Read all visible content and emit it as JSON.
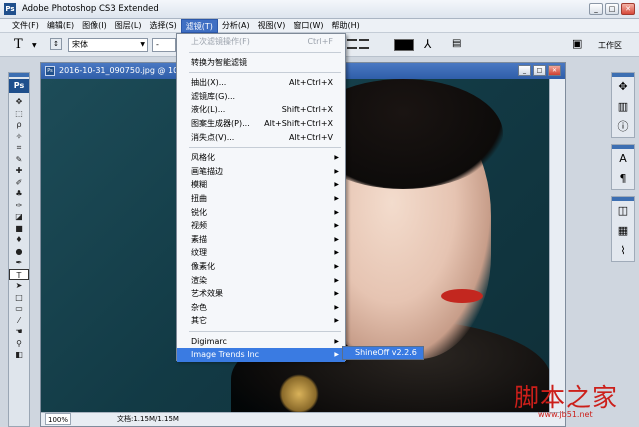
{
  "app": {
    "title": "Adobe Photoshop CS3 Extended",
    "logo": "Ps",
    "window_buttons": {
      "minimize": "_",
      "maximize": "□",
      "close": "✕"
    }
  },
  "menubar": {
    "items": [
      {
        "label": "文件(F)"
      },
      {
        "label": "编辑(E)"
      },
      {
        "label": "图像(I)"
      },
      {
        "label": "图层(L)"
      },
      {
        "label": "选择(S)"
      },
      {
        "label": "滤镜(T)",
        "active": true
      },
      {
        "label": "分析(A)"
      },
      {
        "label": "视图(V)"
      },
      {
        "label": "窗口(W)"
      },
      {
        "label": "帮助(H)"
      }
    ]
  },
  "options_bar": {
    "tool_glyph": "T",
    "font_family": "宋体",
    "font_style": "-",
    "text_color": "#000000",
    "workspace_label": "工作区"
  },
  "document": {
    "title": "2016-10-31_090750.jpg @ 100%",
    "zoom": "100%",
    "doc_size": "文档:1.15M/1.15M"
  },
  "filter_menu": {
    "items": [
      {
        "label": "上次滤镜操作(F)",
        "shortcut": "Ctrl+F",
        "disabled": true
      },
      {
        "sep": true
      },
      {
        "label": "转换为智能滤镜"
      },
      {
        "sep": true
      },
      {
        "label": "抽出(X)...",
        "shortcut": "Alt+Ctrl+X"
      },
      {
        "label": "滤镜库(G)..."
      },
      {
        "label": "液化(L)...",
        "shortcut": "Shift+Ctrl+X"
      },
      {
        "label": "图案生成器(P)...",
        "shortcut": "Alt+Shift+Ctrl+X"
      },
      {
        "label": "消失点(V)...",
        "shortcut": "Alt+Ctrl+V"
      },
      {
        "sep": true
      },
      {
        "label": "风格化",
        "submenu": true
      },
      {
        "label": "画笔描边",
        "submenu": true
      },
      {
        "label": "模糊",
        "submenu": true
      },
      {
        "label": "扭曲",
        "submenu": true
      },
      {
        "label": "锐化",
        "submenu": true
      },
      {
        "label": "视频",
        "submenu": true
      },
      {
        "label": "素描",
        "submenu": true
      },
      {
        "label": "纹理",
        "submenu": true
      },
      {
        "label": "像素化",
        "submenu": true
      },
      {
        "label": "渲染",
        "submenu": true
      },
      {
        "label": "艺术效果",
        "submenu": true
      },
      {
        "label": "杂色",
        "submenu": true
      },
      {
        "label": "其它",
        "submenu": true
      },
      {
        "sep": true
      },
      {
        "label": "Digimarc",
        "submenu": true
      },
      {
        "label": "Image Trends Inc",
        "submenu": true,
        "highlight": true
      }
    ],
    "submenu_item": "ShineOff v2.2.6"
  },
  "watermark": {
    "main": "脚本之家",
    "url": "www.jb51.net"
  },
  "colors": {
    "menu_highlight": "#3a7be2",
    "titlebar_doc": "#2f5ea9",
    "watermark": "#cc1f1a"
  }
}
